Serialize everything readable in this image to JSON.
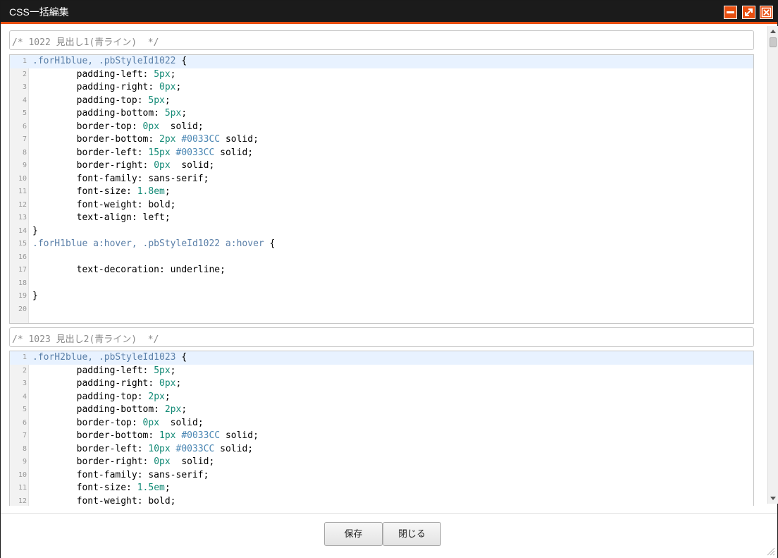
{
  "window": {
    "title": "CSS一括編集"
  },
  "blocks": [
    {
      "comment": "/* 1022 見出し1(青ライン)  */",
      "lines": [
        [
          [
            "sel",
            ".forH1blue, .pbStyleId1022"
          ],
          [
            "plain",
            " {"
          ]
        ],
        [
          [
            "plain",
            "        padding-left: "
          ],
          [
            "num",
            "5px"
          ],
          [
            "plain",
            ";"
          ]
        ],
        [
          [
            "plain",
            "        padding-right: "
          ],
          [
            "num",
            "0px"
          ],
          [
            "plain",
            ";"
          ]
        ],
        [
          [
            "plain",
            "        padding-top: "
          ],
          [
            "num",
            "5px"
          ],
          [
            "plain",
            ";"
          ]
        ],
        [
          [
            "plain",
            "        padding-bottom: "
          ],
          [
            "num",
            "5px"
          ],
          [
            "plain",
            ";"
          ]
        ],
        [
          [
            "plain",
            "        border-top: "
          ],
          [
            "num",
            "0px"
          ],
          [
            "plain",
            "  solid;"
          ]
        ],
        [
          [
            "plain",
            "        border-bottom: "
          ],
          [
            "num",
            "2px"
          ],
          [
            "plain",
            " "
          ],
          [
            "color",
            "#0033CC"
          ],
          [
            "plain",
            " solid;"
          ]
        ],
        [
          [
            "plain",
            "        border-left: "
          ],
          [
            "num",
            "15px"
          ],
          [
            "plain",
            " "
          ],
          [
            "color",
            "#0033CC"
          ],
          [
            "plain",
            " solid;"
          ]
        ],
        [
          [
            "plain",
            "        border-right: "
          ],
          [
            "num",
            "0px"
          ],
          [
            "plain",
            "  solid;"
          ]
        ],
        [
          [
            "plain",
            "        font-family: sans-serif;"
          ]
        ],
        [
          [
            "plain",
            "        font-size: "
          ],
          [
            "num",
            "1.8em"
          ],
          [
            "plain",
            ";"
          ]
        ],
        [
          [
            "plain",
            "        font-weight: bold;"
          ]
        ],
        [
          [
            "plain",
            "        text-align: left;"
          ]
        ],
        [
          [
            "plain",
            "}"
          ]
        ],
        [
          [
            "sel",
            ".forH1blue a:hover, .pbStyleId1022 a:hover"
          ],
          [
            "plain",
            " {"
          ]
        ],
        [
          [
            "plain",
            ""
          ]
        ],
        [
          [
            "plain",
            "        text-decoration: underline;"
          ]
        ],
        [
          [
            "plain",
            ""
          ]
        ],
        [
          [
            "plain",
            "}"
          ]
        ],
        [
          [
            "plain",
            ""
          ]
        ]
      ]
    },
    {
      "comment": "/* 1023 見出し2(青ライン)  */",
      "lines": [
        [
          [
            "sel",
            ".forH2blue, .pbStyleId1023"
          ],
          [
            "plain",
            " {"
          ]
        ],
        [
          [
            "plain",
            "        padding-left: "
          ],
          [
            "num",
            "5px"
          ],
          [
            "plain",
            ";"
          ]
        ],
        [
          [
            "plain",
            "        padding-right: "
          ],
          [
            "num",
            "0px"
          ],
          [
            "plain",
            ";"
          ]
        ],
        [
          [
            "plain",
            "        padding-top: "
          ],
          [
            "num",
            "2px"
          ],
          [
            "plain",
            ";"
          ]
        ],
        [
          [
            "plain",
            "        padding-bottom: "
          ],
          [
            "num",
            "2px"
          ],
          [
            "plain",
            ";"
          ]
        ],
        [
          [
            "plain",
            "        border-top: "
          ],
          [
            "num",
            "0px"
          ],
          [
            "plain",
            "  solid;"
          ]
        ],
        [
          [
            "plain",
            "        border-bottom: "
          ],
          [
            "num",
            "1px"
          ],
          [
            "plain",
            " "
          ],
          [
            "color",
            "#0033CC"
          ],
          [
            "plain",
            " solid;"
          ]
        ],
        [
          [
            "plain",
            "        border-left: "
          ],
          [
            "num",
            "10px"
          ],
          [
            "plain",
            " "
          ],
          [
            "color",
            "#0033CC"
          ],
          [
            "plain",
            " solid;"
          ]
        ],
        [
          [
            "plain",
            "        border-right: "
          ],
          [
            "num",
            "0px"
          ],
          [
            "plain",
            "  solid;"
          ]
        ],
        [
          [
            "plain",
            "        font-family: sans-serif;"
          ]
        ],
        [
          [
            "plain",
            "        font-size: "
          ],
          [
            "num",
            "1.5em"
          ],
          [
            "plain",
            ";"
          ]
        ],
        [
          [
            "plain",
            "        font-weight: bold;"
          ]
        ]
      ]
    }
  ],
  "footer": {
    "save_label": "保存",
    "close_label": "閉じる"
  },
  "colors": {
    "accent": "#e84e10",
    "titlebar": "#1b1b1b",
    "number": "#138a76",
    "selector": "#5a7fa8",
    "hex": "#4a86b3"
  },
  "icons": {
    "minimize": "minimize-icon",
    "maximize": "maximize-icon",
    "close": "close-icon",
    "resize": "resize-grip-icon"
  }
}
